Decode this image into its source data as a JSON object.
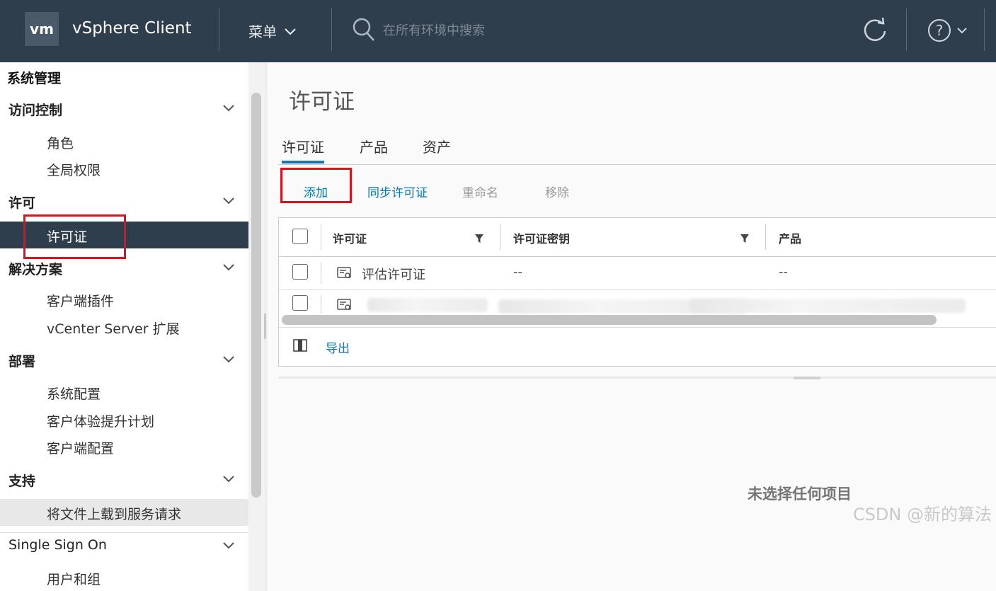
{
  "header": {
    "logo_text": "vm",
    "app_title": "vSphere Client",
    "menu_label": "菜单",
    "search_placeholder": "在所有环境中搜索"
  },
  "sidebar": {
    "title": "系统管理",
    "sections": [
      {
        "label": "访问控制",
        "items": [
          "角色",
          "全局权限"
        ]
      },
      {
        "label": "许可",
        "items": [
          "许可证"
        ]
      },
      {
        "label": "解决方案",
        "items": [
          "客户端插件",
          "vCenter Server 扩展"
        ]
      },
      {
        "label": "部署",
        "items": [
          "系统配置",
          "客户体验提升计划",
          "客户端配置"
        ]
      },
      {
        "label": "支持",
        "items": [
          "将文件上载到服务请求"
        ]
      },
      {
        "label": "Single Sign On",
        "items": [
          "用户和组"
        ]
      }
    ],
    "active_item": "许可证"
  },
  "main": {
    "page_title": "许可证",
    "tabs": [
      "许可证",
      "产品",
      "资产"
    ],
    "actions": {
      "add": "添加",
      "sync": "同步许可证",
      "rename": "重命名",
      "remove": "移除"
    },
    "table": {
      "columns": [
        "许可证",
        "许可证密钥",
        "产品"
      ],
      "rows": [
        {
          "license": "评估许可证",
          "key": "--",
          "product": "--"
        }
      ]
    },
    "export_label": "导出",
    "empty_message": "未选择任何项目"
  },
  "watermark": "CSDN @新的算法",
  "colors": {
    "header_bg": "#2f3e4c",
    "link": "#0079b8",
    "highlight_box": "#e2101b"
  }
}
